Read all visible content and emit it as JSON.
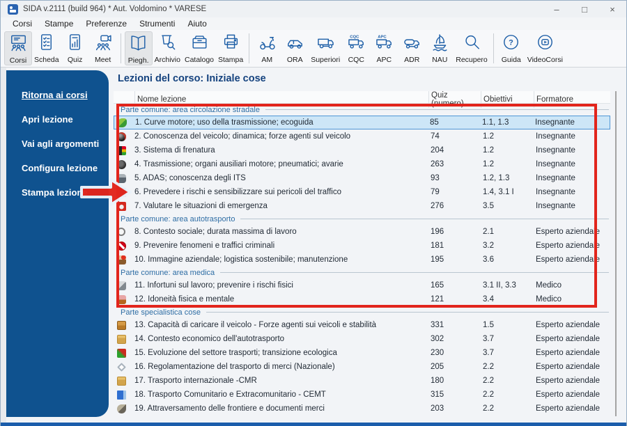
{
  "window": {
    "title": "SIDA v.2111 (build 964) * Aut. Voldomino * VARESE",
    "controls": [
      {
        "name": "minimize",
        "glyph": "–"
      },
      {
        "name": "maximize",
        "glyph": "□"
      },
      {
        "name": "close",
        "glyph": "×"
      }
    ]
  },
  "menu": {
    "items": [
      "Corsi",
      "Stampe",
      "Preferenze",
      "Strumenti",
      "Aiuto"
    ]
  },
  "toolbar": {
    "groups": [
      {
        "buttons": [
          {
            "label": "Corsi",
            "icon": "courses-icon",
            "active": true
          },
          {
            "label": "Scheda",
            "icon": "sheet-checklist-icon",
            "active": false
          },
          {
            "label": "Quiz",
            "icon": "quiz-chart-icon",
            "active": false
          },
          {
            "label": "Meet",
            "icon": "video-meeting-icon",
            "active": false
          }
        ]
      },
      {
        "buttons": [
          {
            "label": "Piegh.",
            "icon": "booklet-icon",
            "active": true
          },
          {
            "label": "Archivio",
            "icon": "archive-search-icon",
            "active": false
          },
          {
            "label": "Catalogo",
            "icon": "catalog-drawer-icon",
            "active": false
          },
          {
            "label": "Stampa",
            "icon": "printer-icon",
            "active": false
          }
        ]
      },
      {
        "buttons": [
          {
            "label": "AM",
            "icon": "scooter-icon",
            "active": false
          },
          {
            "label": "ORA",
            "icon": "car-icon",
            "active": false
          },
          {
            "label": "Superiori",
            "icon": "truck-icon",
            "active": false
          },
          {
            "label": "CQC",
            "icon": "truck-cqc-icon",
            "active": false
          },
          {
            "label": "APC",
            "icon": "truck-apc-icon",
            "active": false
          },
          {
            "label": "ADR",
            "icon": "tanker-truck-icon",
            "active": false
          },
          {
            "label": "NAU",
            "icon": "sailboat-icon",
            "active": false
          },
          {
            "label": "Recupero",
            "icon": "magnifier-icon",
            "active": false
          }
        ]
      },
      {
        "buttons": [
          {
            "label": "Guida",
            "icon": "help-icon",
            "active": false
          },
          {
            "label": "VideoCorsi",
            "icon": "video-play-icon",
            "active": false
          }
        ]
      }
    ]
  },
  "sidebar": {
    "items": [
      {
        "label": "Ritorna ai corsi",
        "underlined": true
      },
      {
        "label": "Apri lezione",
        "underlined": false
      },
      {
        "label": "Vai agli argomenti",
        "underlined": false
      },
      {
        "label": "Configura lezione",
        "underlined": false
      },
      {
        "label": "Stampa lezione",
        "underlined": false
      }
    ]
  },
  "main": {
    "title": "Lezioni del corso: Iniziale cose",
    "table": {
      "columns": [
        "Nome lezione",
        "Quiz (numero)",
        "Obiettivi",
        "Formatore"
      ],
      "sections": [
        {
          "title": "Parte comune: area circolazione stradale",
          "rows": [
            {
              "icon": "eco-leaves-icon",
              "name": "1. Curve motore; uso della trasmissione; ecoguida",
              "quiz": "85",
              "obiettivi": "1.1, 1.3",
              "formatore": "Insegnante",
              "selected": true
            },
            {
              "icon": "wheel-icon",
              "name": "2. Conoscenza del veicolo; dinamica; forze agenti sul veicolo",
              "quiz": "74",
              "obiettivi": "1.2",
              "formatore": "Insegnante",
              "selected": false
            },
            {
              "icon": "tire-trafficlight-icon",
              "name": "3. Sistema di frenatura",
              "quiz": "204",
              "obiettivi": "1.2",
              "formatore": "Insegnante",
              "selected": false
            },
            {
              "icon": "gears-icon",
              "name": "4. Trasmissione; organi ausiliari motore; pneumatici; avarie",
              "quiz": "263",
              "obiettivi": "1.2",
              "formatore": "Insegnante",
              "selected": false
            },
            {
              "icon": "robot-icon",
              "name": "5. ADAS; conoscenza degli ITS",
              "quiz": "93",
              "obiettivi": "1.2, 1.3",
              "formatore": "Insegnante",
              "selected": false
            },
            {
              "icon": "truck-hazard-icon",
              "name": "6. Prevedere i rischi e sensibilizzare sui pericoli del traffico",
              "quiz": "79",
              "obiettivi": "1.4, 3.1 I",
              "formatore": "Insegnante",
              "selected": false
            },
            {
              "icon": "emergency-button-icon",
              "name": "7. Valutare le situazioni di emergenza",
              "quiz": "276",
              "obiettivi": "3.5",
              "formatore": "Insegnante",
              "selected": false
            }
          ]
        },
        {
          "title": "Parte comune: area autotrasporto",
          "rows": [
            {
              "icon": "clock-icon",
              "name": "8. Contesto sociale; durata massima di lavoro",
              "quiz": "196",
              "obiettivi": "2.1",
              "formatore": "Esperto aziendale",
              "selected": false
            },
            {
              "icon": "no-entry-icon",
              "name": "9. Prevenire fenomeni e traffici criminali",
              "quiz": "181",
              "obiettivi": "3.2",
              "formatore": "Esperto aziendale",
              "selected": false
            },
            {
              "icon": "person-heart-icon",
              "name": "10. Immagine aziendale; logistica sostenibile; manutenzione",
              "quiz": "195",
              "obiettivi": "3.6",
              "formatore": "Esperto aziendale",
              "selected": false
            }
          ]
        },
        {
          "title": "Parte comune: area medica",
          "rows": [
            {
              "icon": "person-fall-icon",
              "name": "11. Infortuni sul lavoro; prevenire i rischi fisici",
              "quiz": "165",
              "obiettivi": "3.1 II, 3.3",
              "formatore": "Medico",
              "selected": false
            },
            {
              "icon": "person-health-icon",
              "name": "12. Idoneità fisica e mentale",
              "quiz": "121",
              "obiettivi": "3.4",
              "formatore": "Medico",
              "selected": false
            }
          ]
        },
        {
          "title": "Parte specialistica cose",
          "rows": [
            {
              "icon": "cargo-box-icon",
              "name": "13. Capacità di caricare il veicolo - Forze agenti sui veicoli e stabilità",
              "quiz": "331",
              "obiettivi": "1.5",
              "formatore": "Esperto aziendale",
              "selected": false
            },
            {
              "icon": "folder-money-icon",
              "name": "14. Contesto economico dell'autotrasporto",
              "quiz": "302",
              "obiettivi": "3.7",
              "formatore": "Esperto aziendale",
              "selected": false
            },
            {
              "icon": "eco-pen-icon",
              "name": "15. Evoluzione del settore trasporti; transizione ecologica",
              "quiz": "230",
              "obiettivi": "3.7",
              "formatore": "Esperto aziendale",
              "selected": false
            },
            {
              "icon": "diamond-sign-icon",
              "name": "16. Regolamentazione del trasporto di merci (Nazionale)",
              "quiz": "205",
              "obiettivi": "2.2",
              "formatore": "Esperto aziendale",
              "selected": false
            },
            {
              "icon": "folder-doc-icon",
              "name": "17. Trasporto internazionale -CMR",
              "quiz": "180",
              "obiettivi": "2.2",
              "formatore": "Esperto aziendale",
              "selected": false
            },
            {
              "icon": "blue-book-icon",
              "name": "18. Trasporto Comunitario e Extracomunitario - CEMT",
              "quiz": "315",
              "obiettivi": "2.2",
              "formatore": "Esperto aziendale",
              "selected": false
            },
            {
              "icon": "bird-border-icon",
              "name": "19. Attraversamento delle frontiere e documenti merci",
              "quiz": "203",
              "obiettivi": "2.2",
              "formatore": "Esperto aziendale",
              "selected": false
            }
          ]
        }
      ]
    }
  },
  "annotations": {
    "highlight_box": {
      "color": "#e2251c",
      "encloses": "lessons 1-12 (parte comune sections)"
    },
    "arrow": {
      "color": "#e2251c",
      "points_to": "6. Prevedere i rischi e sensibilizzare sui pericoli del traffico"
    }
  },
  "colors": {
    "sidebar_blue": "#0f528f",
    "title_blue": "#14427e",
    "section_blue": "#2e6da4",
    "toolbar_icon_blue": "#1e5fa7",
    "selection_bg": "#cde6f7",
    "selection_border": "#4f96d6",
    "annotation_red": "#e2251c"
  }
}
